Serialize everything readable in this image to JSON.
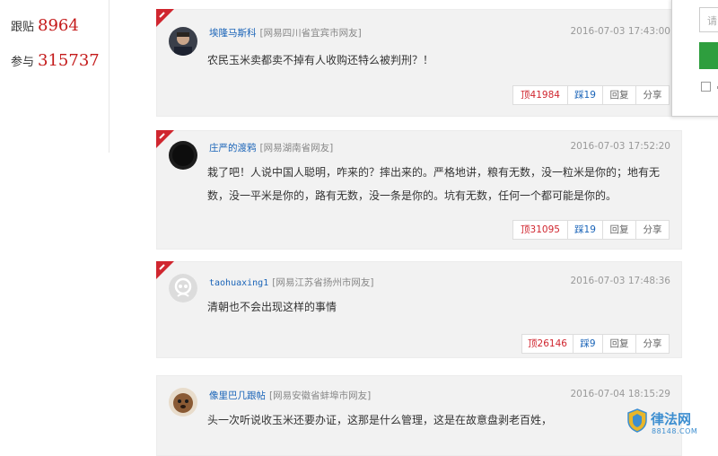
{
  "stats": {
    "follow_label": "跟贴",
    "follow_count": "8964",
    "join_label": "参与",
    "join_count": "315737"
  },
  "comments": [
    {
      "username": "埃隆马斯科",
      "location": "[网易四川省宜宾市网友]",
      "time": "2016-07-03 17:43:00",
      "text": "农民玉米卖都卖不掉有人收购还特么被判刑？！",
      "up": "顶41984",
      "down": "踩19",
      "reply": "回复",
      "share": "分享"
    },
    {
      "username": "庄严的渡鸦",
      "location": "[网易湖南省网友]",
      "time": "2016-07-03 17:52:20",
      "text": "栽了吧！人说中国人聪明，咋来的？摔出来的。严格地讲，粮有无数，没一粒米是你的；地有无数，没一平米是你的，路有无数，没一条是你的。坑有无数，任何一个都可能是你的。",
      "up": "顶31095",
      "down": "踩19",
      "reply": "回复",
      "share": "分享"
    },
    {
      "username": "taohuaxing1",
      "location": "[网易江苏省扬州市网友]",
      "time": "2016-07-03 17:48:36",
      "text": "清朝也不会出现这样的事情",
      "up": "顶26146",
      "down": "踩9",
      "reply": "回复",
      "share": "分享"
    },
    {
      "username": "像里巴几跟帖",
      "location": "[网易安徽省蚌埠市网友]",
      "time": "2016-07-04 18:15:29",
      "text": "头一次听说收玉米还要办证，这那是什么管理，这是在故意盘剥老百姓，"
    }
  ],
  "popup": {
    "input_placeholder": "请"
  },
  "watermark": {
    "title": "律法网",
    "url": "88148.COM"
  },
  "colors": {
    "accent_red": "#d0262f",
    "link_blue": "#1a64b8",
    "button_green": "#2e9e3e",
    "card_bg": "#f2f2f2"
  }
}
